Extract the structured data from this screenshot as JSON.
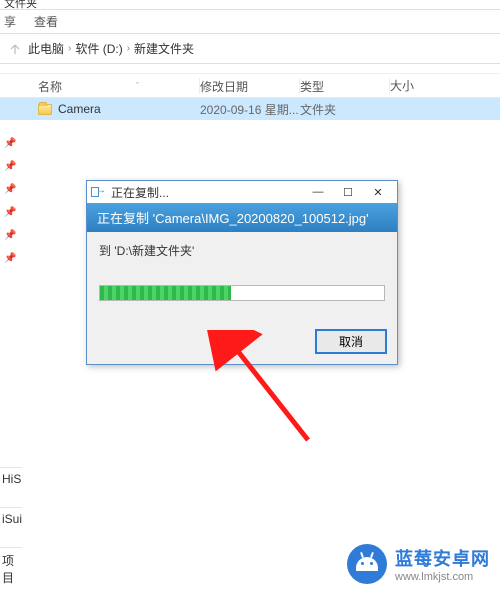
{
  "window": {
    "title_fragment": "文件夹"
  },
  "ribbon": {
    "share": "享",
    "view": "查看"
  },
  "breadcrumb": {
    "root": "此电脑",
    "drive": "软件 (D:)",
    "folder": "新建文件夹"
  },
  "columns": {
    "name": "名称",
    "date": "修改日期",
    "type": "类型",
    "size": "大小"
  },
  "rows": [
    {
      "name": "Camera",
      "date": "2020-09-16 星期...",
      "type": "文件夹"
    }
  ],
  "left_bottom": {
    "item1": "HiS",
    "item2": "iSui",
    "status": "项目"
  },
  "dialog": {
    "title": "正在复制...",
    "blue_text": "正在复制 'Camera\\IMG_20200820_100512.jpg'",
    "dest_prefix": "到",
    "dest_path": "'D:\\新建文件夹'",
    "cancel": "取消",
    "progress_pct": 46
  },
  "watermark": {
    "title": "蓝莓安卓网",
    "url": "www.lmkjst.com"
  }
}
